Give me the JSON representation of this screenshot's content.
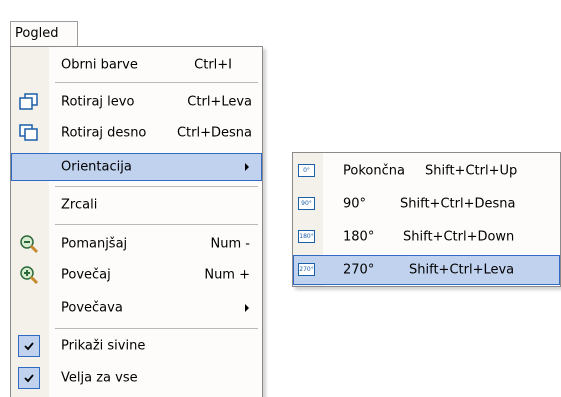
{
  "menubar": {
    "pogled": "Pogled"
  },
  "main_menu": {
    "obrni": {
      "label": "Obrni barve",
      "shortcut": "Ctrl+I"
    },
    "rotiraj_levo": {
      "label": "Rotiraj levo",
      "shortcut": "Ctrl+Leva"
    },
    "rotiraj_desno": {
      "label": "Rotiraj desno",
      "shortcut": "Ctrl+Desna"
    },
    "orientacija": {
      "label": "Orientacija"
    },
    "zrcali": {
      "label": "Zrcali"
    },
    "pomanjsaj": {
      "label": "Pomanjšaj",
      "shortcut": "Num -"
    },
    "povecaj": {
      "label": "Povečaj",
      "shortcut": "Num +"
    },
    "povecava": {
      "label": "Povečava"
    },
    "prikazi_sivine": {
      "label": "Prikaži sivine",
      "checked": true
    },
    "velja_za_vse": {
      "label": "Velja za vse",
      "checked": true
    }
  },
  "orientation_submenu": {
    "pokoncna": {
      "label": "Pokončna",
      "shortcut": "Shift+Ctrl+Up",
      "icon": "0°"
    },
    "r90": {
      "label": "90°",
      "shortcut": "Shift+Ctrl+Desna",
      "icon": "90°"
    },
    "r180": {
      "label": "180°",
      "shortcut": "Shift+Ctrl+Down",
      "icon": "180°"
    },
    "r270": {
      "label": "270°",
      "shortcut": "Shift+Ctrl+Leva",
      "icon": "270°"
    }
  },
  "colors": {
    "highlight_bg": "#c1d2ee",
    "highlight_border": "#316ac5",
    "gutter": "#f3f1ea",
    "menu_bg": "#fdfcfa"
  }
}
